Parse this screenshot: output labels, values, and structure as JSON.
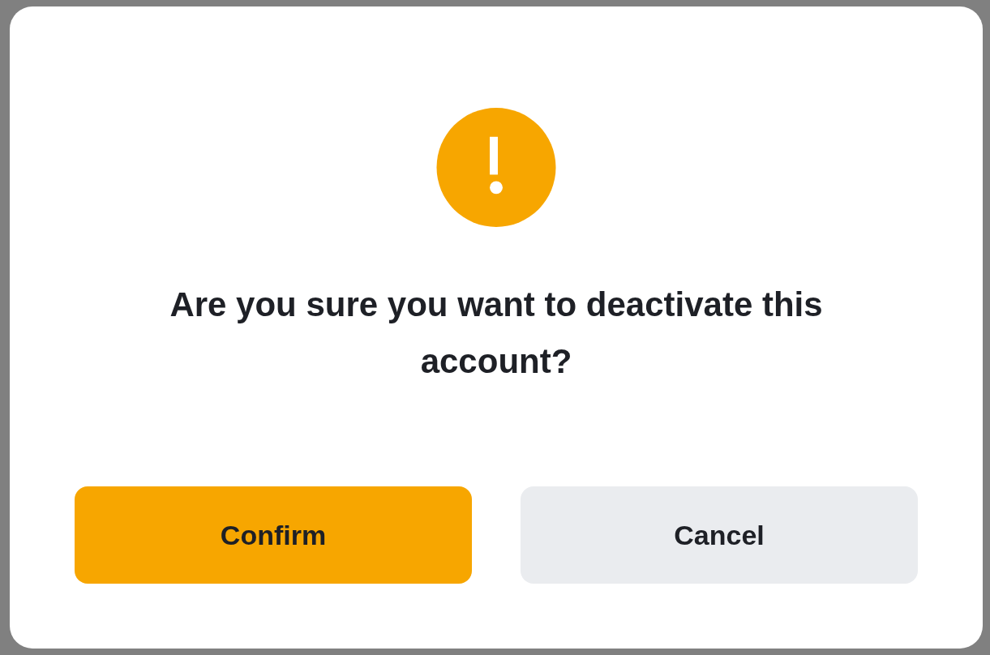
{
  "dialog": {
    "title": "Are you sure you want to deactivate this account?",
    "buttons": [
      {
        "label": "Confirm",
        "kind": "primary"
      },
      {
        "label": "Cancel",
        "kind": "secondary"
      }
    ]
  }
}
